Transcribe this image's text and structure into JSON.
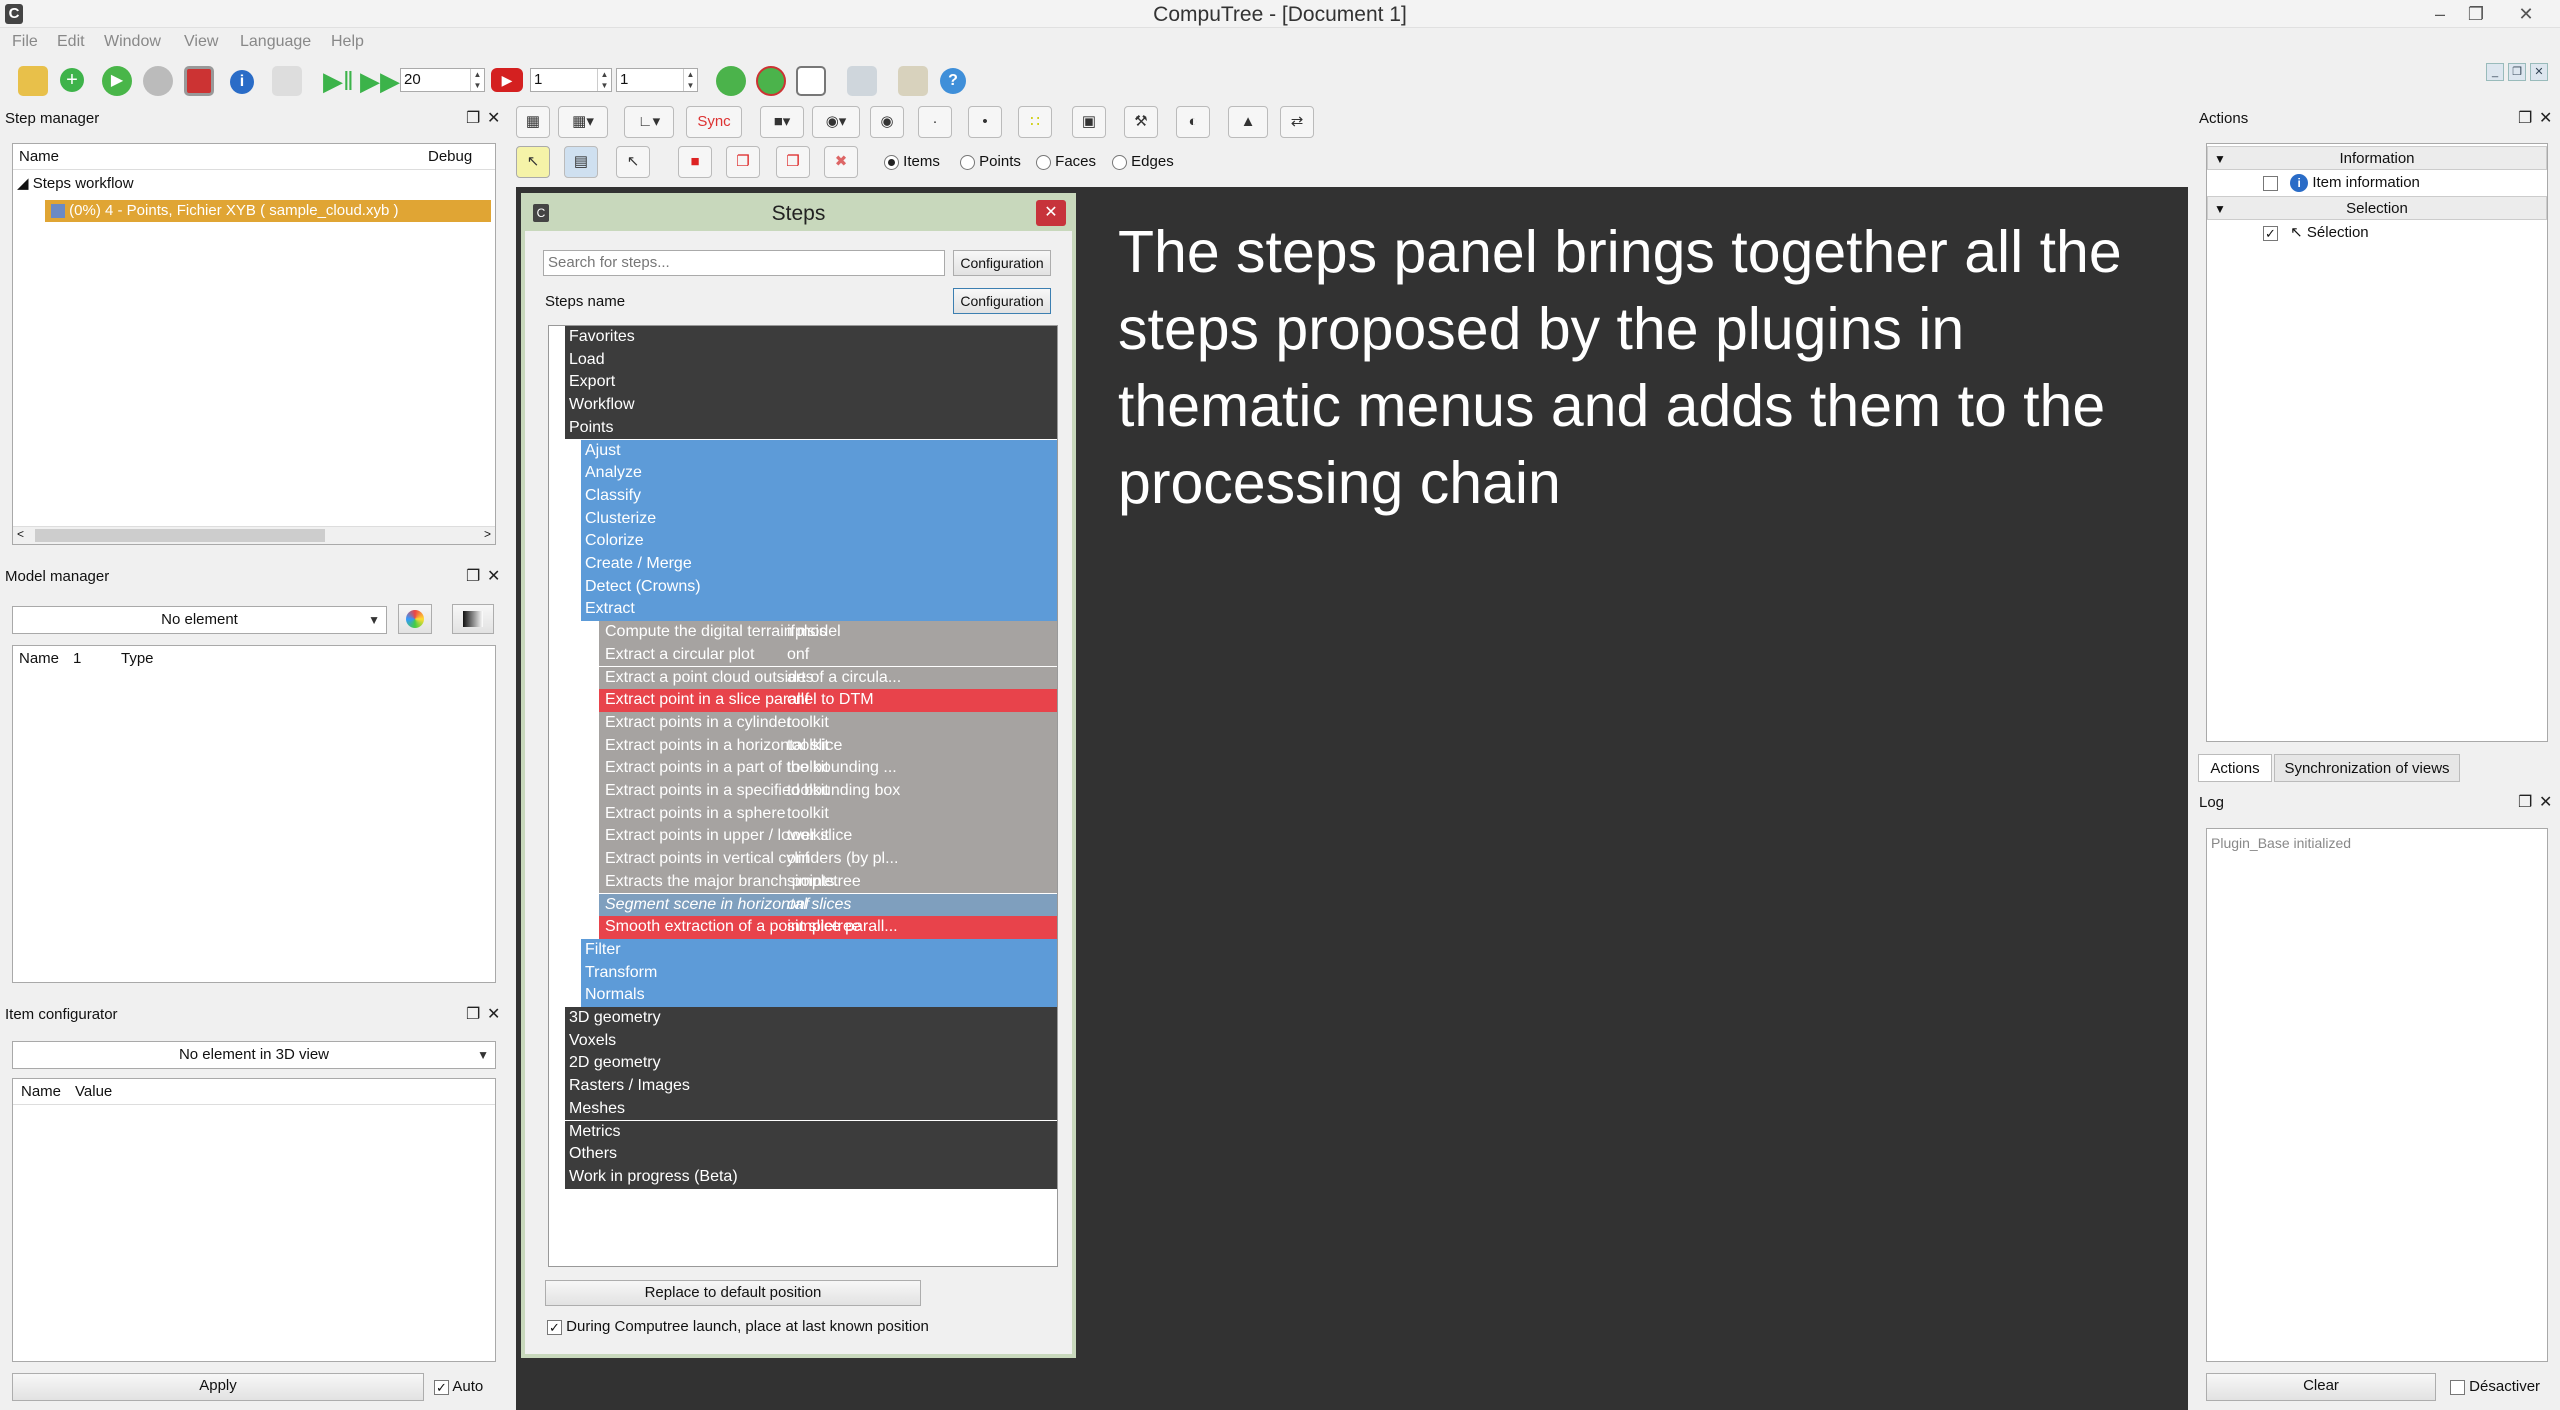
{
  "window": {
    "title": "CompuTree - [Document 1]",
    "logo": "C"
  },
  "menu": [
    "File",
    "Edit",
    "Window",
    "View",
    "Language",
    "Help"
  ],
  "toolbar": {
    "spin1": "20",
    "spin2": "1",
    "spin3": "1"
  },
  "view_toolbar": {
    "sync_label": "Sync",
    "radio_items": "Items",
    "radio_points": "Points",
    "radio_faces": "Faces",
    "radio_edges": "Edges"
  },
  "step_manager": {
    "title": "Step manager",
    "col_name": "Name",
    "col_debug": "Debug",
    "root": "Steps workflow",
    "step": "(0%) 4 - Points, Fichier XYB ( sample_cloud.xyb )"
  },
  "model_manager": {
    "title": "Model manager",
    "combo": "No element",
    "col_name": "Name",
    "col_1": "1",
    "col_type": "Type"
  },
  "item_configurator": {
    "title": "Item configurator",
    "combo": "No element in 3D view",
    "col_name": "Name",
    "col_value": "Value",
    "apply": "Apply",
    "auto": "Auto"
  },
  "steps_panel": {
    "title": "Steps",
    "search_placeholder": "Search for steps...",
    "config_btn_1": "Configuration",
    "steps_name_label": "Steps name",
    "config_btn_2": "Configuration",
    "categories_top": [
      "Favorites",
      "Load",
      "Export",
      "Workflow",
      "Points"
    ],
    "points_sub": [
      "Ajust",
      "Analyze",
      "Classify",
      "Clusterize",
      "Colorize",
      "Create / Merge",
      "Detect (Crowns)",
      "Extract"
    ],
    "extract_steps": [
      {
        "name": "Compute the digital terrain model",
        "plugin": "ifplsis",
        "style": "leaf"
      },
      {
        "name": "Extract a circular plot",
        "plugin": "onf",
        "style": "leaf"
      },
      {
        "name": "Extract a point cloud outside of a circula...",
        "plugin": "arts",
        "style": "leaf"
      },
      {
        "name": "Extract point in a slice parallel to DTM",
        "plugin": "onf",
        "style": "leaf-red"
      },
      {
        "name": "Extract points in a cylinder",
        "plugin": "toolkit",
        "style": "leaf"
      },
      {
        "name": "Extract points in a horizontal slice",
        "plugin": "toolkit",
        "style": "leaf"
      },
      {
        "name": "Extract points in a part of the bounding ...",
        "plugin": "toolkit",
        "style": "leaf"
      },
      {
        "name": "Extract points in a specified bounding box",
        "plugin": "toolkit",
        "style": "leaf"
      },
      {
        "name": "Extract points in a sphere",
        "plugin": "toolkit",
        "style": "leaf"
      },
      {
        "name": "Extract points in upper / lower slice",
        "plugin": "toolkit",
        "style": "leaf"
      },
      {
        "name": "Extract points in vertical cylinders (by pl...",
        "plugin": "onf",
        "style": "leaf"
      },
      {
        "name": "Extracts the major branch points.",
        "plugin": "simpletree",
        "style": "leaf"
      },
      {
        "name": "Segment scene in horizontal slices",
        "plugin": "onf",
        "style": "leaf-sel"
      },
      {
        "name": "Smooth extraction of a point slice parall...",
        "plugin": "simpletree",
        "style": "leaf-red"
      }
    ],
    "points_sub_after": [
      "Filter",
      "Transform",
      "Normals"
    ],
    "categories_bottom": [
      "3D geometry",
      "Voxels",
      "2D geometry",
      "Rasters / Images",
      "Meshes",
      "Metrics",
      "Others",
      "Work in progress (Beta)"
    ],
    "replace_btn": "Replace to default position",
    "launch_check": "During Computree launch, place at last known position"
  },
  "overlay_text": "The steps panel brings together all the steps proposed by the plugins in thematic menus and adds them to the processing chain",
  "actions": {
    "title": "Actions",
    "group_information": "Information",
    "item_information": "Item information",
    "group_selection": "Selection",
    "selection": "Sélection",
    "tab_actions": "Actions",
    "tab_sync": "Synchronization of views"
  },
  "log": {
    "title": "Log",
    "line": "Plugin_Base initialized",
    "clear": "Clear",
    "disable": "Désactiver"
  },
  "colors": {
    "viewport": "#323232",
    "category": "#3c3c3c",
    "subcategory": "#5d9bd8",
    "step": "#a6a3a1",
    "step_highlight": "#e8434b",
    "step_selected": "#7f9fbe",
    "step_manager_selected": "#e0a534"
  }
}
